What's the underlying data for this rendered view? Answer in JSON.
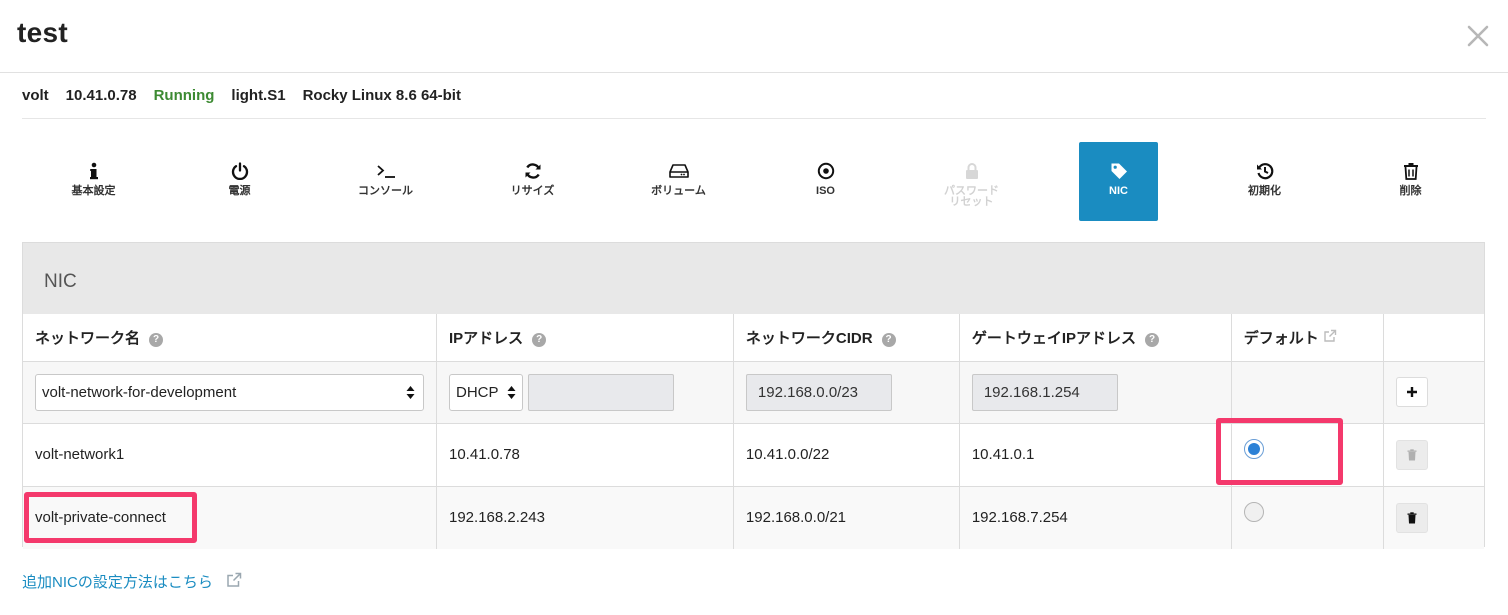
{
  "modal": {
    "title": "test",
    "close_icon": "close-icon"
  },
  "summary": {
    "name": "volt",
    "ip": "10.41.0.78",
    "status": "Running",
    "plan": "light.S1",
    "os": "Rocky Linux 8.6 64-bit"
  },
  "tabs": [
    {
      "label": "基本設定",
      "icon": "info-icon"
    },
    {
      "label": "電源",
      "icon": "power-icon"
    },
    {
      "label": "コンソール",
      "icon": "console-icon"
    },
    {
      "label": "リサイズ",
      "icon": "refresh-icon"
    },
    {
      "label": "ボリューム",
      "icon": "drive-icon"
    },
    {
      "label": "ISO",
      "icon": "disc-icon"
    },
    {
      "label_line1": "パスワード",
      "label_line2": "リセット",
      "icon": "lock-icon",
      "disabled": true
    },
    {
      "label": "NIC",
      "icon": "tag-icon",
      "active": true
    },
    {
      "label": "初期化",
      "icon": "history-icon"
    },
    {
      "label": "削除",
      "icon": "trash-icon"
    }
  ],
  "panel": {
    "title": "NIC",
    "columns": {
      "network": "ネットワーク名",
      "ip": "IPアドレス",
      "cidr": "ネットワークCIDR",
      "gateway": "ゲートウェイIPアドレス",
      "default": "デフォルト"
    },
    "input_row": {
      "network_select": "volt-network-for-development",
      "ip_mode": "DHCP",
      "ip_value": "",
      "cidr": "192.168.0.0/23",
      "gateway": "192.168.1.254",
      "add_icon": "plus-icon"
    },
    "rows": [
      {
        "network": "volt-network1",
        "ip": "10.41.0.78",
        "cidr": "10.41.0.0/22",
        "gateway": "10.41.0.1",
        "default": true
      },
      {
        "network": "volt-private-connect",
        "ip": "192.168.2.243",
        "cidr": "192.168.0.0/21",
        "gateway": "192.168.7.254",
        "default": false
      }
    ]
  },
  "help_link": "追加NICの設定方法はこちら",
  "colors": {
    "accent": "#1a8cc1",
    "running": "#3c8a32",
    "highlight": "#f4396c"
  }
}
